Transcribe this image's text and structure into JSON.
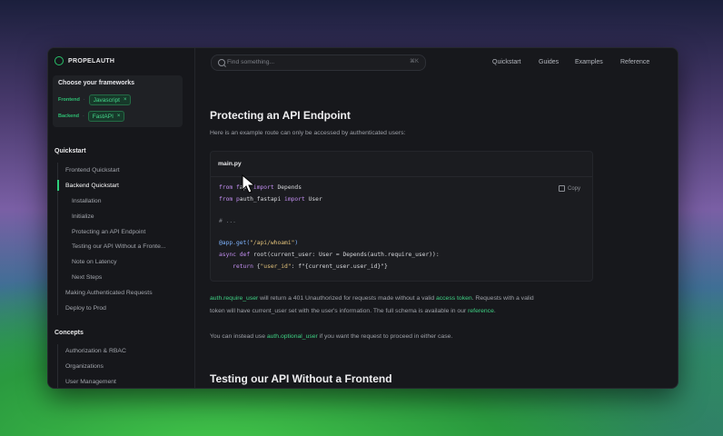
{
  "brand": {
    "name": "PROPELAUTH"
  },
  "frameworks": {
    "title": "Choose your frameworks",
    "frontend_key": "Frontend",
    "frontend_value": "Javascript",
    "backend_key": "Backend",
    "backend_value": "FastAPI",
    "remove_glyph": "×",
    "sep": "·"
  },
  "search": {
    "placeholder": "Find something...",
    "shortcut": "⌘K"
  },
  "topnav": [
    "Quickstart",
    "Guides",
    "Examples",
    "Reference"
  ],
  "sidebar": {
    "quickstart_heading": "Quickstart",
    "quickstart_items": [
      "Frontend Quickstart",
      "Backend Quickstart",
      "Installation",
      "Initialize",
      "Protecting an API Endpoint",
      "Testing our API Without a Fronte...",
      "Note on Latency",
      "Next Steps",
      "Making Authenticated Requests",
      "Deploy to Prod"
    ],
    "concepts_heading": "Concepts",
    "concepts_items": [
      "Authorization & RBAC",
      "Organizations",
      "User Management"
    ]
  },
  "main": {
    "heading1": "Protecting an API Endpoint",
    "intro": "Here is an example route can only be accessed by authenticated users:",
    "code": {
      "filename": "main.py",
      "copy_label": "Copy",
      "l1_a": "from f",
      "l1_b": "api ",
      "l1_c": "import",
      "l1_d": " Depends",
      "l2_a": "from p",
      "l2_b": "auth_fastapi ",
      "l2_c": "import",
      "l2_d": " User",
      "l3": "# ...",
      "l4_a": "@app.get(",
      "l4_b": "\"/api/whoami\"",
      "l4_c": ")",
      "l5_a": "async def",
      "l5_b": " root(current_user: User = Depends(auth.require_user)):",
      "l6_a": "    return",
      "l6_b": " {",
      "l6_c": "\"user_id\"",
      "l6_d": ": f\"{current_user.user_id}\"}"
    },
    "p1_a": "auth.require_user",
    "p1_b": " will return a 401 Unauthorized for requests made without a valid ",
    "p1_c": "access token",
    "p1_d": ". Requests with a valid",
    "p2_a": "token will have current_user set with the user's information. The full schema is available in our ",
    "p2_b": "reference",
    "p2_c": ".",
    "p3_a": "You can instead use ",
    "p3_b": "auth.optional_user",
    "p3_c": " if you want the request to proceed in either case.",
    "heading2": "Testing our API Without a Frontend"
  }
}
